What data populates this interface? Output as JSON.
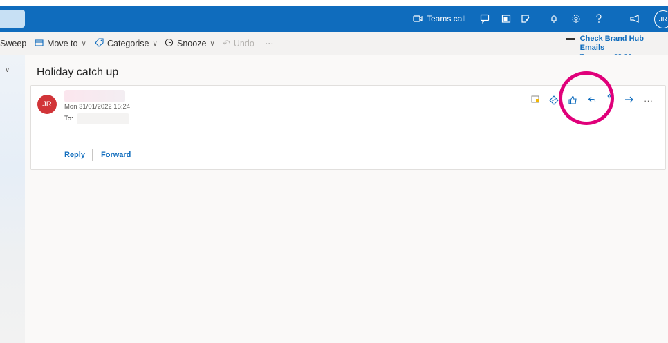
{
  "topbar": {
    "teams_call_label": "Teams call",
    "avatar_initials": "JR",
    "icons": [
      "video-camera-icon",
      "chat-icon",
      "office-icon",
      "whiteboard-icon",
      "bell-icon",
      "gear-icon",
      "help-icon",
      "megaphone-icon"
    ],
    "color": "#0f6cbd"
  },
  "toolbar": {
    "sweep_label": "Sweep",
    "move_to_label": "Move to",
    "categorise_label": "Categorise",
    "snooze_label": "Snooze",
    "undo_label": "Undo",
    "more_label": "···"
  },
  "reminder": {
    "title": "Check Brand Hub Emails",
    "time": "Tomorrow 09:00"
  },
  "message": {
    "subject": "Holiday catch up",
    "sender_initials": "JR",
    "sent_date": "Mon 31/01/2022 15:24",
    "to_label": "To:",
    "reply_label": "Reply",
    "forward_label": "Forward",
    "avatar_color": "#d13438"
  },
  "annotation": {
    "color": "#e0007a"
  }
}
